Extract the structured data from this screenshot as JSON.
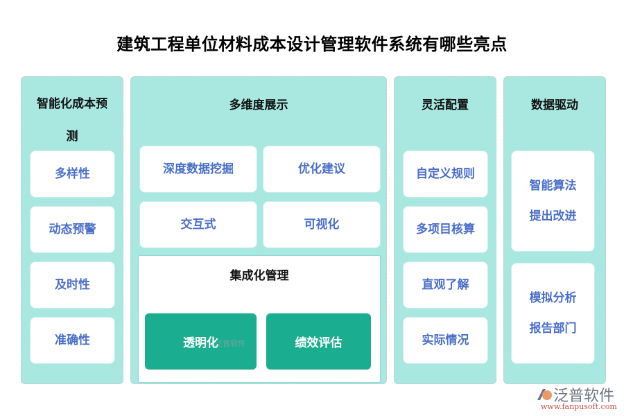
{
  "title": "建筑工程单位材料成本设计管理软件系统有哪些亮点",
  "columns": [
    {
      "heading_line1": "智能化成本预",
      "heading_line2": "测",
      "items": [
        "多样性",
        "动态预警",
        "及时性",
        "准确性"
      ]
    },
    {
      "heading": "多维度展示",
      "items": [
        "深度数据挖掘",
        "优化建议",
        "交互式",
        "可视化"
      ],
      "sub_panel": {
        "heading": "集成化管理",
        "items": [
          "透明化",
          "绩效评估"
        ]
      }
    },
    {
      "heading": "灵活配置",
      "items": [
        "自定义规则",
        "多项目核算",
        "直观了解",
        "实际情况"
      ]
    },
    {
      "heading": "数据驱动",
      "items": [
        {
          "line1": "智能算法",
          "line2": "提出改进"
        },
        {
          "line1": "模拟分析",
          "line2": "报告部门"
        }
      ]
    }
  ],
  "watermark": "泛普软件",
  "logo": {
    "icon": "fanpu-logo-icon",
    "name": "泛普软件",
    "url": "www.fanpusoft.com"
  },
  "colors": {
    "panel_bg": "#a8e8e1",
    "card_text": "#4a6fc9",
    "green_button": "#1aad8f"
  }
}
